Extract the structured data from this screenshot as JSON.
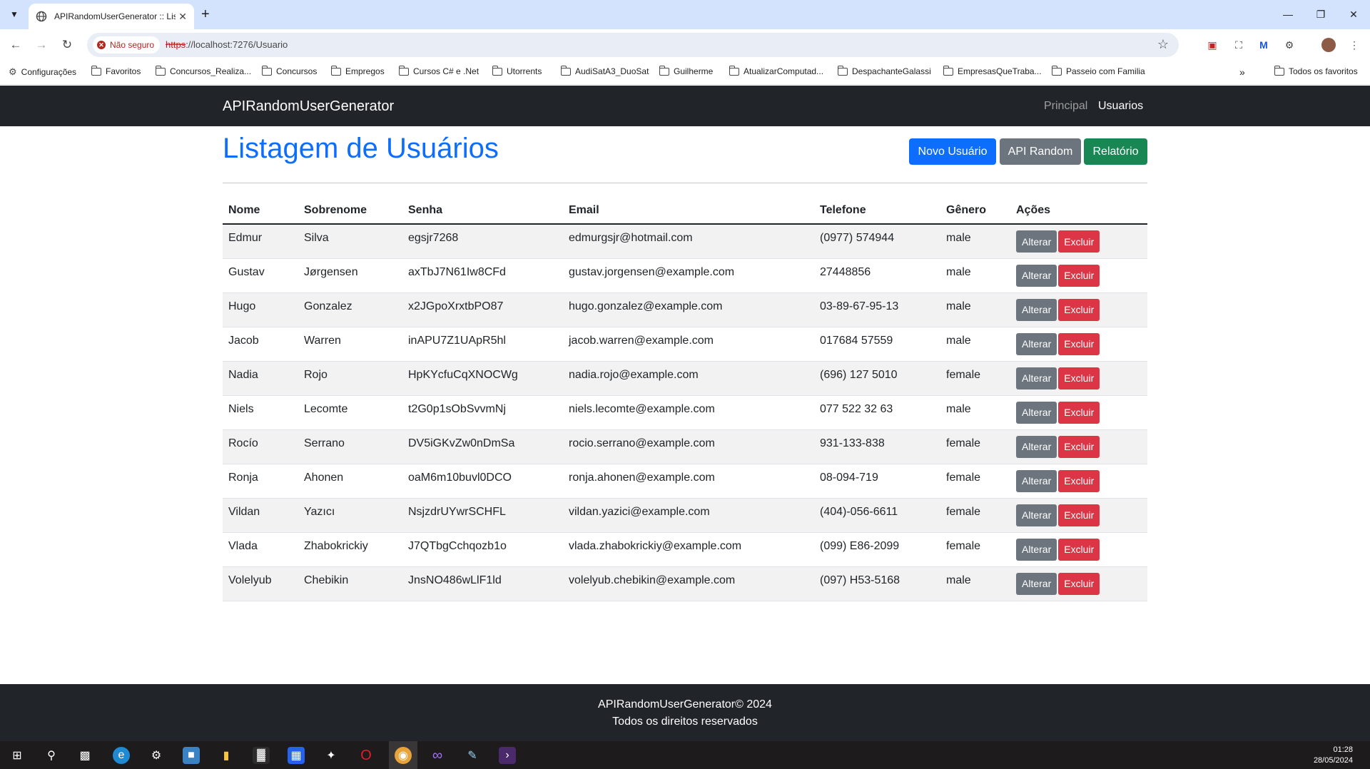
{
  "browser": {
    "tab_title": "APIRandomUserGenerator :: Listagem de Usuários",
    "security_label": "Não seguro",
    "url_scheme": "https",
    "url_rest": "://localhost:7276/Usuario",
    "bookmarks": [
      "Configurações",
      "Favoritos",
      "Concursos_Realiza...",
      "Concursos",
      "Empregos",
      "Cursos C# e .Net",
      "Utorrents",
      "AudiSatA3_DuoSat",
      "Guilherme",
      "AtualizarComputad...",
      "DespachanteGalassi",
      "EmpresasQueTraba...",
      "Passeio com Familia"
    ],
    "all_bookmarks": "Todos os favoritos"
  },
  "nav": {
    "brand": "APIRandomUserGenerator",
    "links": [
      "Principal",
      "Usuarios"
    ]
  },
  "page": {
    "title": "Listagem de Usuários",
    "buttons": {
      "new": "Novo Usuário",
      "api": "API Random",
      "report": "Relatório"
    }
  },
  "table": {
    "headers": [
      "Nome",
      "Sobrenome",
      "Senha",
      "Email",
      "Telefone",
      "Gênero",
      "Ações"
    ],
    "action_edit": "Alterar",
    "action_delete": "Excluir",
    "rows": [
      [
        "Edmur",
        "Silva",
        "egsjr7268",
        "edmurgsjr@hotmail.com",
        "(0977) 574944",
        "male"
      ],
      [
        "Gustav",
        "Jørgensen",
        "axTbJ7N61Iw8CFd",
        "gustav.jorgensen@example.com",
        "27448856",
        "male"
      ],
      [
        "Hugo",
        "Gonzalez",
        "x2JGpoXrxtbPO87",
        "hugo.gonzalez@example.com",
        "03-89-67-95-13",
        "male"
      ],
      [
        "Jacob",
        "Warren",
        "inAPU7Z1UApR5hl",
        "jacob.warren@example.com",
        "017684 57559",
        "male"
      ],
      [
        "Nadia",
        "Rojo",
        "HpKYcfuCqXNOCWg",
        "nadia.rojo@example.com",
        "(696) 127 5010",
        "female"
      ],
      [
        "Niels",
        "Lecomte",
        "t2G0p1sObSvvmNj",
        "niels.lecomte@example.com",
        "077 522 32 63",
        "male"
      ],
      [
        "Rocío",
        "Serrano",
        "DV5iGKvZw0nDmSa",
        "rocio.serrano@example.com",
        "931-133-838",
        "female"
      ],
      [
        "Ronja",
        "Ahonen",
        "oaM6m10buvl0DCO",
        "ronja.ahonen@example.com",
        "08-094-719",
        "female"
      ],
      [
        "Vildan",
        "Yazıcı",
        "NsjzdrUYwrSCHFL",
        "vildan.yazici@example.com",
        "(404)-056-6611",
        "female"
      ],
      [
        "Vlada",
        "Zhabokrickiy",
        "J7QTbgCchqozb1o",
        "vlada.zhabokrickiy@example.com",
        "(099) E86-2099",
        "female"
      ],
      [
        "Volelyub",
        "Chebikin",
        "JnsNO486wLlF1ld",
        "volelyub.chebikin@example.com",
        "(097) H53-5168",
        "male"
      ]
    ]
  },
  "footer": {
    "line1": "APIRandomUserGenerator© 2024",
    "line2": "Todos os direitos reservados"
  },
  "taskbar": {
    "time": "01:28",
    "date": "28/05/2024"
  },
  "colors": {
    "primary": "#0d6efd",
    "secondary": "#6c757d",
    "success": "#198754",
    "danger": "#dc3545",
    "navbar": "#212529"
  }
}
